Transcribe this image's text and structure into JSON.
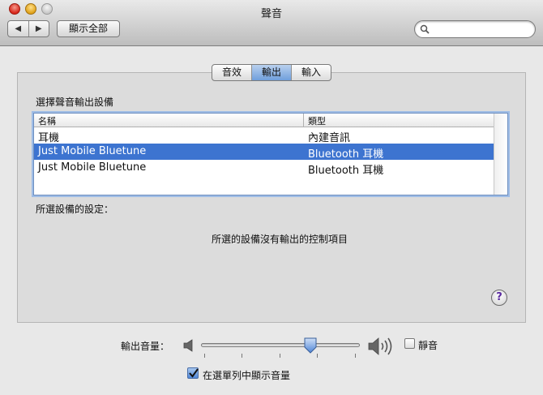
{
  "window": {
    "title": "聲音"
  },
  "toolbar": {
    "back_glyph": "◀",
    "forward_glyph": "▶",
    "show_all_label": "顯示全部",
    "search_placeholder": ""
  },
  "tabs": [
    {
      "label": "音效",
      "active": false
    },
    {
      "label": "輸出",
      "active": true
    },
    {
      "label": "輸入",
      "active": false
    }
  ],
  "output": {
    "section_label": "選擇聲音輸出設備",
    "columns": {
      "name": "名稱",
      "type": "類型"
    },
    "rows": [
      {
        "name": "耳機",
        "type": "內建音訊",
        "selected": false
      },
      {
        "name": "Just Mobile Bluetune",
        "type": "Bluetooth 耳機",
        "selected": true
      },
      {
        "name": "Just Mobile Bluetune",
        "type": "Bluetooth 耳機",
        "selected": false
      }
    ],
    "settings_label": "所選設備的設定：",
    "no_controls_text": "所選的設備沒有輸出的控制項目",
    "help_glyph": "?"
  },
  "volume": {
    "label": "輸出音量：",
    "level": 0.7,
    "mute_label": "靜音",
    "muted": false,
    "show_in_menu_label": "在選單列中顯示音量",
    "show_in_menu": true
  },
  "colors": {
    "selection": "#3d74d0",
    "active_tab": "#7ea8e0"
  }
}
